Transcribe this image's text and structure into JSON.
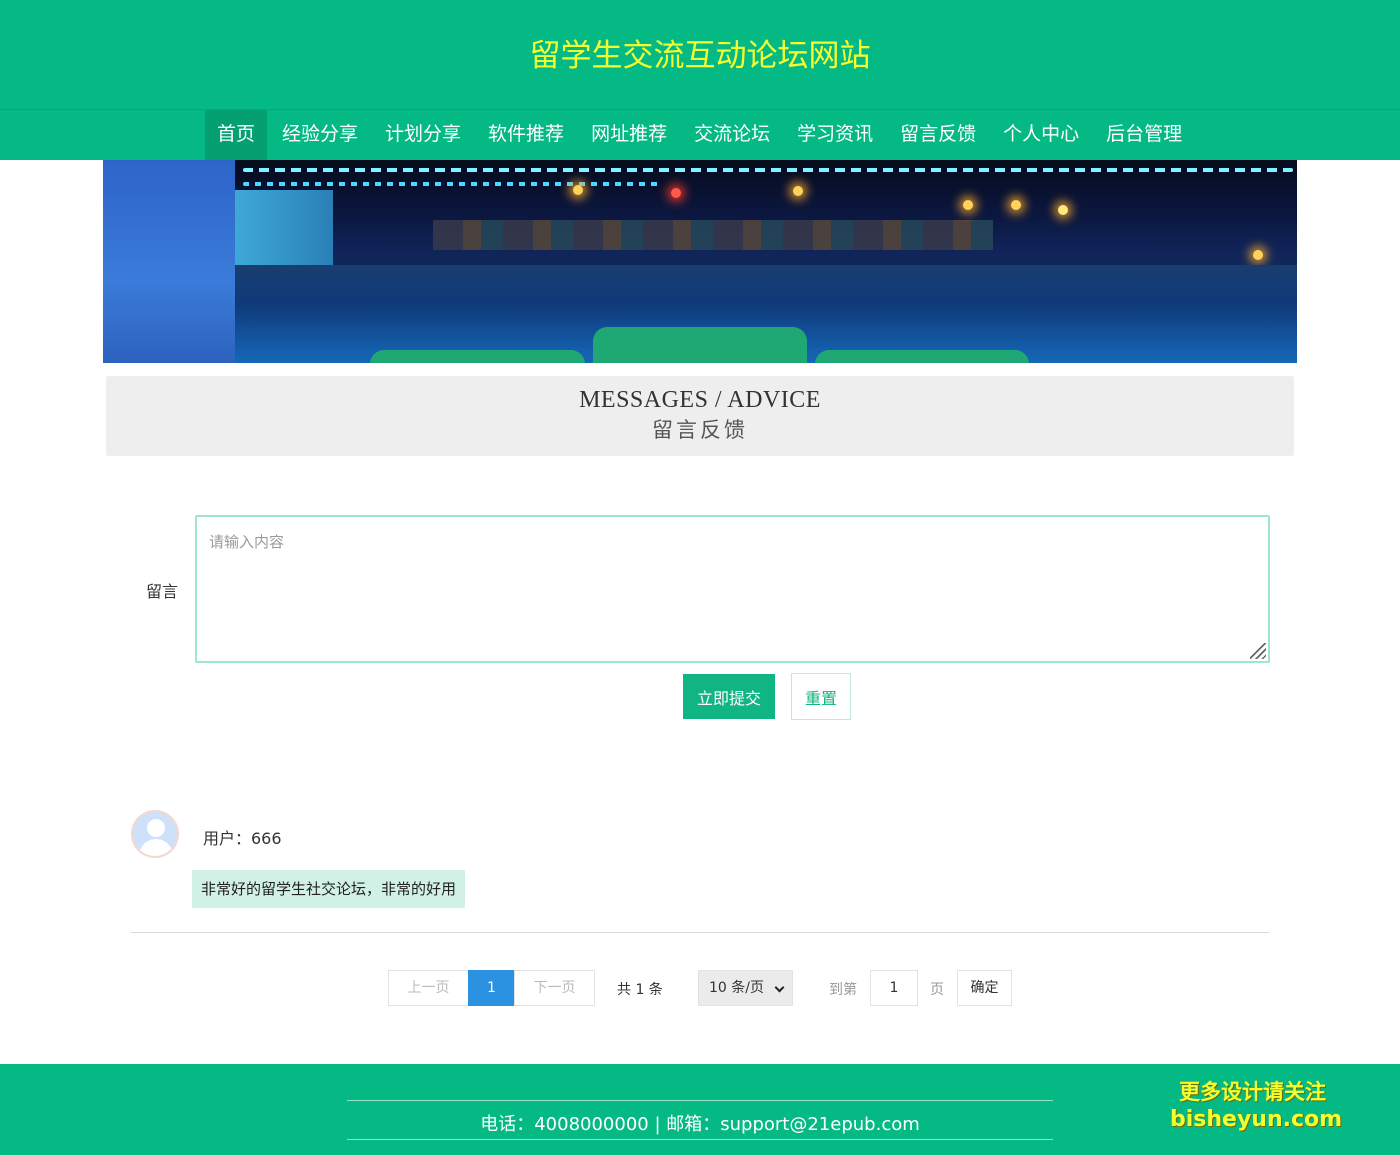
{
  "header": {
    "site_title": "留学生交流互动论坛网站",
    "title_color": "#f4ff2e",
    "brand_color": "#05b985"
  },
  "nav": {
    "items": [
      {
        "label": "首页",
        "active": true
      },
      {
        "label": "经验分享"
      },
      {
        "label": "计划分享"
      },
      {
        "label": "软件推荐"
      },
      {
        "label": "网址推荐"
      },
      {
        "label": "交流论坛"
      },
      {
        "label": "学习资讯"
      },
      {
        "label": "留言反馈"
      },
      {
        "label": "个人中心"
      },
      {
        "label": "后台管理"
      }
    ]
  },
  "section_title": {
    "en": "MESSAGES / ADVICE",
    "cn": "留言反馈"
  },
  "form": {
    "label": "留言",
    "placeholder": "请输入内容",
    "value": "",
    "submit_label": "立即提交",
    "reset_label": "重置"
  },
  "messages": [
    {
      "user": "用户：666",
      "content": "非常好的留学生社交论坛，非常的好用"
    }
  ],
  "pagination": {
    "prev_label": "上一页",
    "current_page": "1",
    "next_label": "下一页",
    "total_text": "共 1 条",
    "page_size": "10 条/页",
    "goto_label": "到第",
    "goto_value": "1",
    "page_word": "页",
    "confirm_label": "确定"
  },
  "footer": {
    "contact": "电话：4008000000 | 邮箱：support@21epub.com"
  },
  "watermark": {
    "line1": "更多设计请关注",
    "line2": "bisheyun.com"
  }
}
